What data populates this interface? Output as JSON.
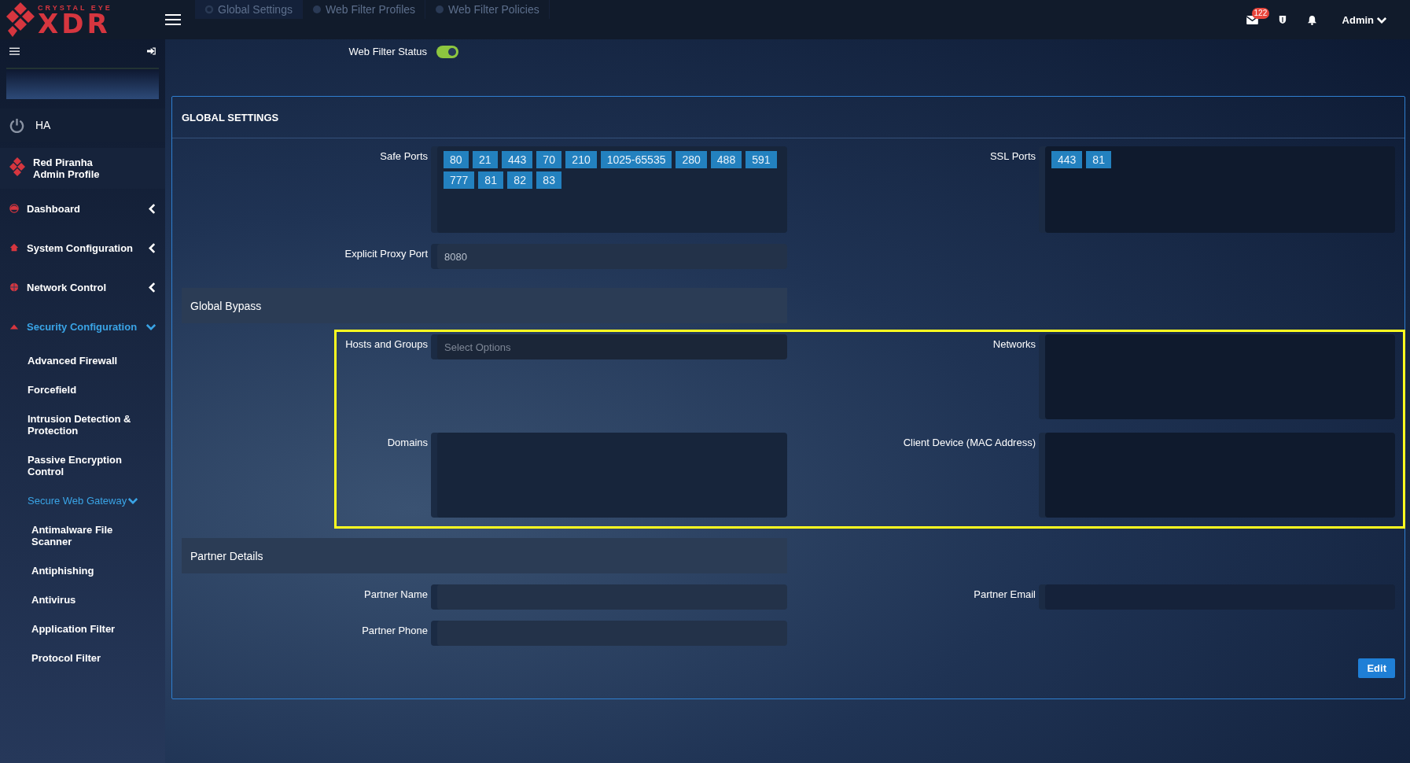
{
  "header": {
    "logo_top": "CRYSTAL EYE",
    "logo_main": "XDR",
    "tabs": [
      {
        "label": "Global Settings",
        "selected": true
      },
      {
        "label": "Web Filter Profiles",
        "selected": false
      },
      {
        "label": "Web Filter Policies",
        "selected": false
      }
    ],
    "mail_count": "122",
    "user": "Admin"
  },
  "sidebar": {
    "ha": "HA",
    "profile_name": "Red Piranha",
    "profile_role": "Admin Profile",
    "items": [
      {
        "label": "Dashboard",
        "expanded": false
      },
      {
        "label": "System Configuration",
        "expanded": false
      },
      {
        "label": "Network Control",
        "expanded": false
      },
      {
        "label": "Security Configuration",
        "expanded": true,
        "children": [
          {
            "label": "Advanced Firewall"
          },
          {
            "label": "Forcefield"
          },
          {
            "label": "Intrusion Detection & Protection"
          },
          {
            "label": "Passive Encryption Control"
          },
          {
            "label": "Secure Web Gateway",
            "expanded": true,
            "children": [
              {
                "label": "Antimalware File Scanner"
              },
              {
                "label": "Antiphishing"
              },
              {
                "label": "Antivirus"
              },
              {
                "label": "Application Filter"
              },
              {
                "label": "Protocol Filter"
              }
            ]
          }
        ]
      }
    ]
  },
  "web_filter_status": {
    "label": "Web Filter Status",
    "on": true
  },
  "global_settings": {
    "title": "GLOBAL SETTINGS",
    "safe_ports": {
      "label": "Safe Ports",
      "tags": [
        "80",
        "21",
        "443",
        "70",
        "210",
        "1025-65535",
        "280",
        "488",
        "591",
        "777",
        "81",
        "82",
        "83"
      ]
    },
    "ssl_ports": {
      "label": "SSL Ports",
      "tags": [
        "443",
        "81"
      ]
    },
    "explicit_proxy_port": {
      "label": "Explicit Proxy Port",
      "value": "8080"
    },
    "global_bypass": {
      "title": "Global Bypass",
      "hosts_and_groups": {
        "label": "Hosts and Groups",
        "placeholder": "Select Options"
      },
      "networks": {
        "label": "Networks"
      },
      "domains": {
        "label": "Domains"
      },
      "client_device": {
        "label": "Client Device (MAC Address)"
      }
    },
    "partner_details": {
      "title": "Partner Details",
      "partner_name": {
        "label": "Partner Name"
      },
      "partner_email": {
        "label": "Partner Email"
      },
      "partner_phone": {
        "label": "Partner Phone"
      }
    },
    "edit_button": "Edit"
  }
}
